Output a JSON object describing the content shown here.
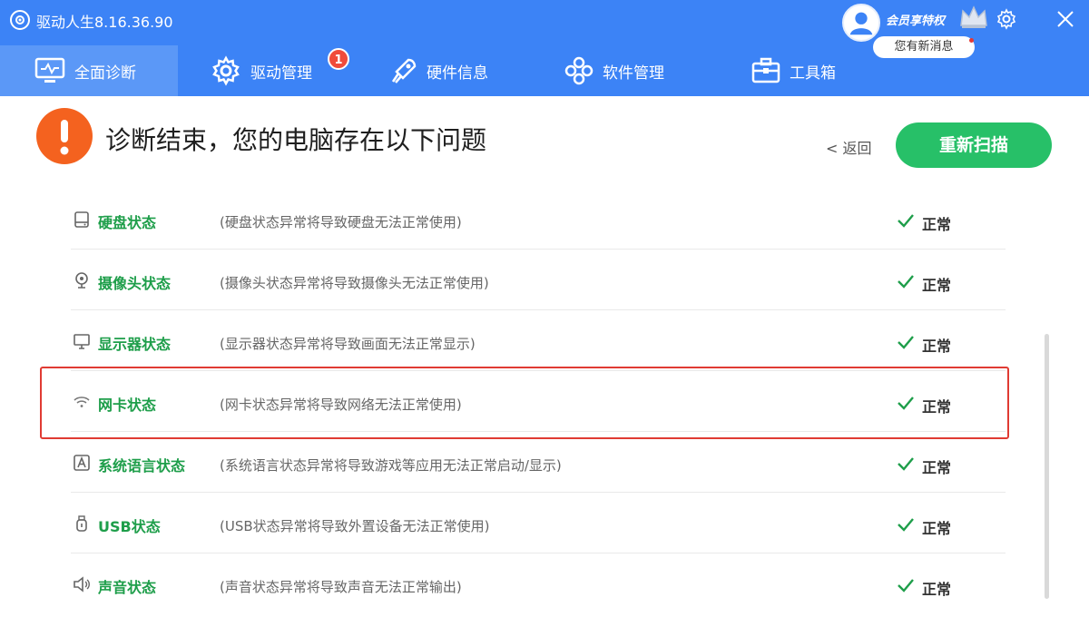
{
  "app": {
    "title": "驱动人生8.16.36.90",
    "vip_label": "会员享特权",
    "message_label": "您有新消息",
    "icon_set": [
      "app-logo-icon",
      "user-avatar-icon",
      "crown-icon",
      "gear-icon",
      "close-icon"
    ]
  },
  "tabs": [
    {
      "label": "全面诊断",
      "icon": "monitor-icon",
      "active": true
    },
    {
      "label": "驱动管理",
      "icon": "gear-icon",
      "badge": "1"
    },
    {
      "label": "硬件信息",
      "icon": "rocket-icon"
    },
    {
      "label": "软件管理",
      "icon": "apps-icon"
    },
    {
      "label": "工具箱",
      "icon": "toolbox-icon"
    }
  ],
  "result": {
    "title": "诊断结束，您的电脑存在以下问题",
    "back_label": "< 返回",
    "rescan_label": "重新扫描"
  },
  "rows": [
    {
      "name": "硬盘状态",
      "desc": "(硬盘状态异常将导致硬盘无法正常使用)",
      "status": "正常",
      "icon": "hard-disk-icon"
    },
    {
      "name": "摄像头状态",
      "desc": "(摄像头状态异常将导致摄像头无法正常使用)",
      "status": "正常",
      "icon": "camera-icon"
    },
    {
      "name": "显示器状态",
      "desc": "(显示器状态异常将导致画面无法正常显示)",
      "status": "正常",
      "icon": "display-icon"
    },
    {
      "name": "网卡状态",
      "desc": "(网卡状态异常将导致网络无法正常使用)",
      "status": "正常",
      "icon": "wifi-icon",
      "highlighted": true
    },
    {
      "name": "系统语言状态",
      "desc": "(系统语言状态异常将导致游戏等应用无法正常启动/显示)",
      "status": "正常",
      "icon": "language-icon"
    },
    {
      "name": "USB状态",
      "desc": "(USB状态异常将导致外置设备无法正常使用)",
      "status": "正常",
      "icon": "usb-icon"
    },
    {
      "name": "声音状态",
      "desc": "(声音状态异常将导致声音无法正常输出)",
      "status": "正常",
      "icon": "speaker-icon"
    }
  ],
  "colors": {
    "header_bg": "#3c83f6",
    "active_tab_bg": "#5b98f7",
    "ok_green": "#1e9e4a",
    "rescan_button": "#27c068",
    "warning_orange": "#f4621f",
    "highlight_red": "#e03b33"
  }
}
